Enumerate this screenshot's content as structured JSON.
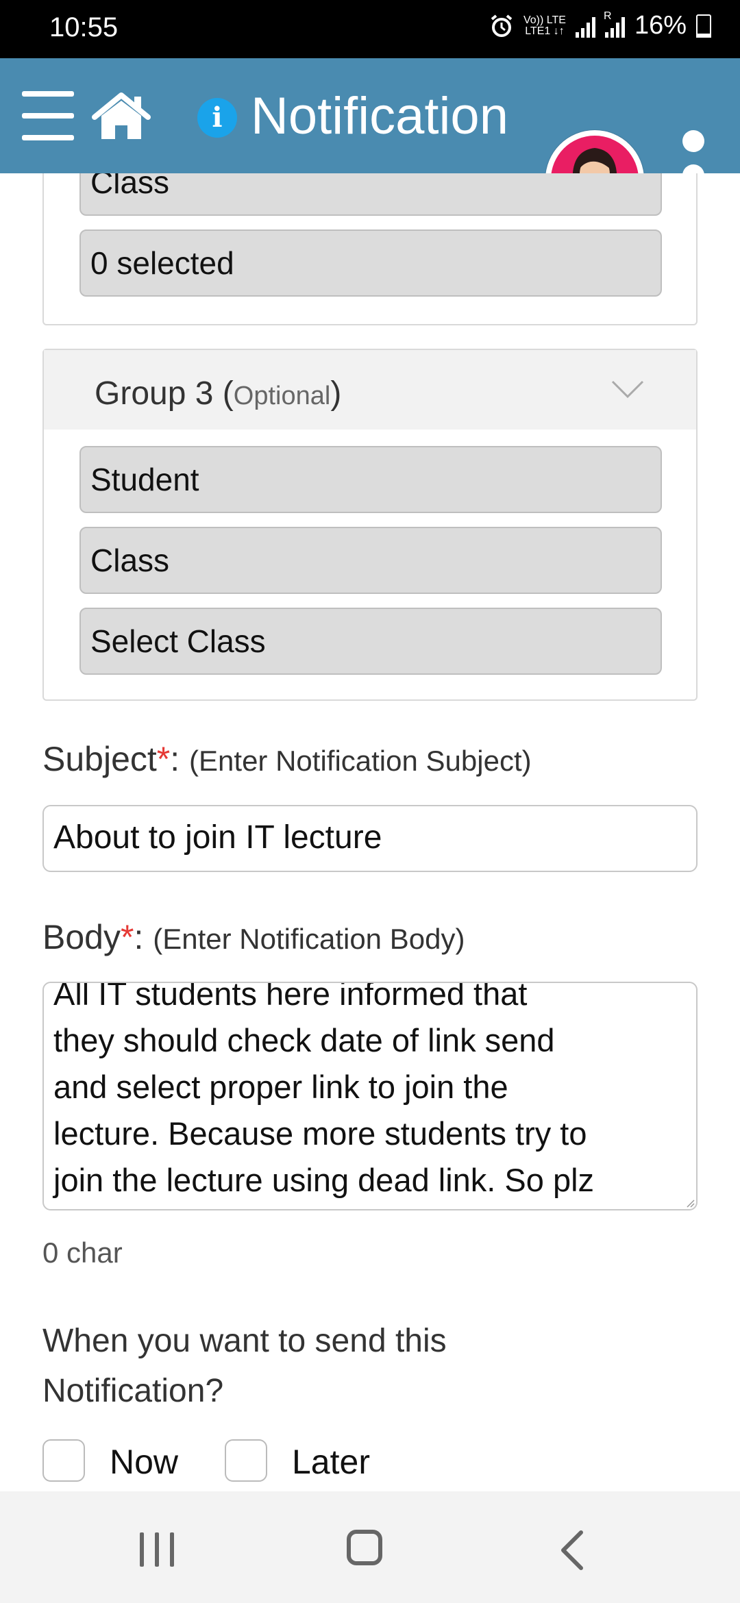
{
  "status_bar": {
    "time": "10:55",
    "network_top": "Vo)) LTE",
    "network_bottom": "LTE1 ↓↑",
    "roaming": "R",
    "battery": "16%"
  },
  "app_bar": {
    "title": "Notification",
    "icons": [
      "hamburger-menu-icon",
      "home-icon",
      "info-icon",
      "user-avatar",
      "more-vert-icon"
    ],
    "color": "#4a8bb0"
  },
  "group2": {
    "field_class": "Class",
    "field_selected": "0 selected"
  },
  "group3": {
    "title": "Group 3",
    "optional_open": " (",
    "optional": "Optional",
    "optional_close": ")",
    "field_student": "Student",
    "field_class": "Class",
    "field_select_class": "Select Class"
  },
  "subject": {
    "label": "Subject",
    "required_mark": "*",
    "colon": ": ",
    "hint": "(Enter Notification Subject)",
    "value": "About to join IT lecture"
  },
  "body": {
    "label": "Body",
    "required_mark": "*",
    "colon": ": ",
    "hint": "(Enter Notification Body)",
    "lines": [
      "All IT students  here informed that",
      "they should check date of link send",
      "and select proper link to join the",
      "lecture. Because more students try to",
      "join the lecture using dead link.  So plz"
    ],
    "char_count": "0 char"
  },
  "schedule": {
    "question_line1": "When you want to send this",
    "question_line2": "Notification?",
    "option_now": "Now",
    "option_later": "Later",
    "now_checked": false,
    "later_checked": false
  },
  "colors": {
    "required": "#e53935",
    "field_bg": "#dcdcdc",
    "info_icon": "#1aa3ea",
    "avatar_ring": "#e91e63"
  }
}
